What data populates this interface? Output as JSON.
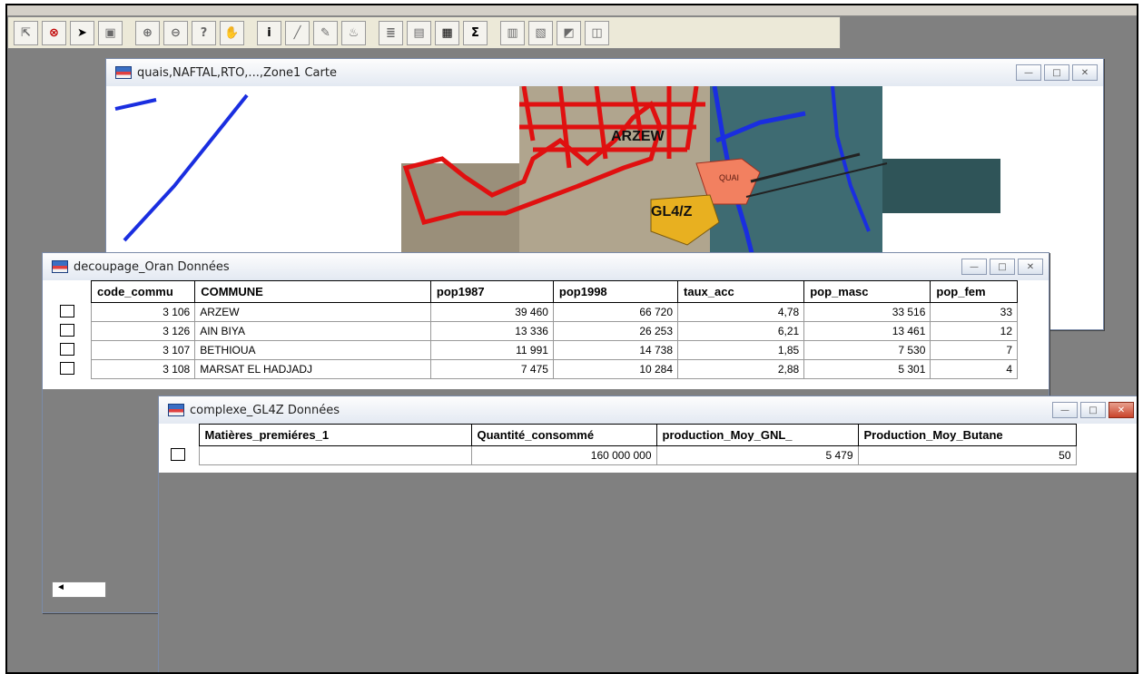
{
  "toolbar": {
    "buttons": [
      {
        "icon": "select-arrow-disabled-icon",
        "glyph": "⇱"
      },
      {
        "icon": "stop-icon",
        "glyph": "⊗"
      },
      {
        "icon": "pointer-icon",
        "glyph": "➤"
      },
      {
        "icon": "marquee-select-icon",
        "glyph": "▣"
      },
      {
        "icon": "zoom-in-icon",
        "glyph": "⊕"
      },
      {
        "icon": "zoom-out-icon",
        "glyph": "⊖"
      },
      {
        "icon": "zoom-query-icon",
        "glyph": "?"
      },
      {
        "icon": "pan-hand-icon",
        "glyph": "✋"
      },
      {
        "icon": "info-icon",
        "glyph": "i"
      },
      {
        "icon": "ruler-icon",
        "glyph": "╱"
      },
      {
        "icon": "label-icon",
        "glyph": "✎"
      },
      {
        "icon": "drag-map-icon",
        "glyph": "♨"
      },
      {
        "icon": "layer-control-icon",
        "glyph": "≣"
      },
      {
        "icon": "legend-icon",
        "glyph": "▤"
      },
      {
        "icon": "browse-table-icon",
        "glyph": "▦"
      },
      {
        "icon": "statistics-sum-icon",
        "glyph": "Σ"
      },
      {
        "icon": "layout-icon",
        "glyph": "▥"
      },
      {
        "icon": "reshape-icon",
        "glyph": "▧"
      },
      {
        "icon": "graph-icon",
        "glyph": "◩"
      },
      {
        "icon": "redistrict-icon",
        "glyph": "◫"
      }
    ]
  },
  "map_window": {
    "title": "quais,NAFTAL,RTO,...,Zone1 Carte",
    "labels": {
      "arzew": "ARZEW",
      "quai": "QUAI",
      "gl4z": "GL4/Z"
    }
  },
  "window_controls": {
    "minimize": "—",
    "maximize": "□",
    "close": "✕"
  },
  "decoupage_window": {
    "title": "decoupage_Oran Données",
    "columns": [
      "code_commu",
      "COMMUNE",
      "pop1987",
      "pop1998",
      "taux_acc",
      "pop_masc",
      "pop_fem"
    ],
    "rows": [
      [
        "3 106",
        "ARZEW",
        "39 460",
        "66 720",
        "4,78",
        "33 516",
        "33"
      ],
      [
        "3 126",
        "AIN BIYA",
        "13 336",
        "26 253",
        "6,21",
        "13 461",
        "12"
      ],
      [
        "3 107",
        "BETHIOUA",
        "11 991",
        "14 738",
        "1,85",
        "7 530",
        "7"
      ],
      [
        "3 108",
        "MARSAT EL HADJADJ",
        "7 475",
        "10 284",
        "2,88",
        "5 301",
        "4"
      ]
    ],
    "scroll_left": "◄"
  },
  "complexe_window": {
    "title": "complexe_GL4Z Données",
    "columns": [
      "Matières_premiéres_1",
      "Quantité_consommé",
      "production_Moy_GNL_",
      "Production_Moy_Butane"
    ],
    "rows": [
      [
        "",
        "160 000 000",
        "5 479",
        "50"
      ]
    ]
  }
}
